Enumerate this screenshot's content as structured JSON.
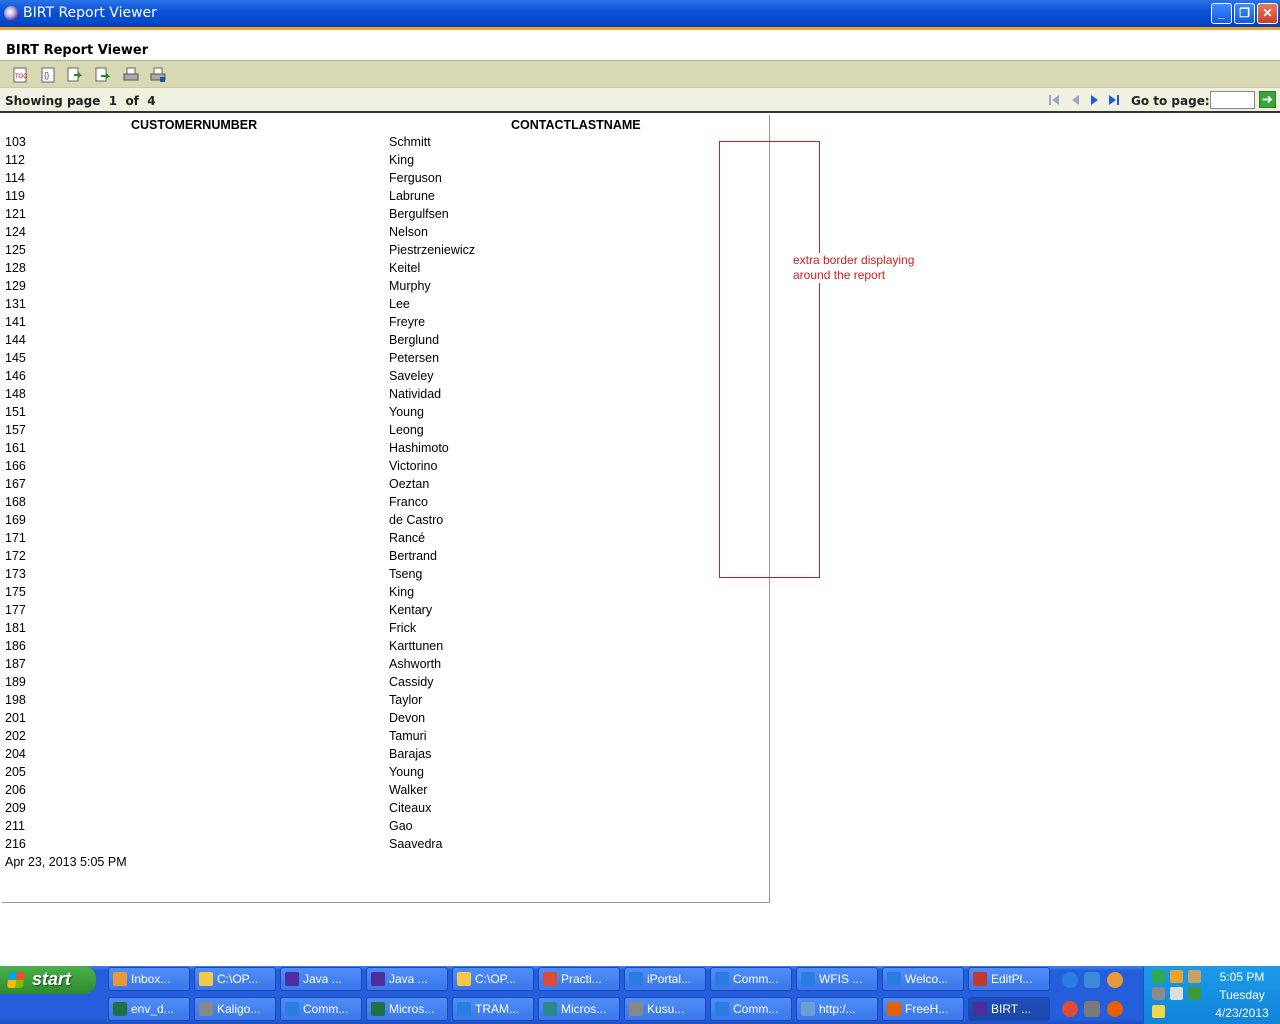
{
  "window": {
    "title": "BIRT Report Viewer",
    "buttons": {
      "minimize": "_",
      "maximize": "❐",
      "close": "✕"
    }
  },
  "report_title": "BIRT Report Viewer",
  "toolbar": {
    "icons": [
      "toc-icon",
      "parameters-icon",
      "export-data-icon",
      "export-report-icon",
      "print-icon",
      "print-server-icon"
    ]
  },
  "navigation": {
    "showing_label": "Showing page",
    "current_page": "1",
    "of_label": "of",
    "total_pages": "4",
    "goto_label": "Go to page:"
  },
  "table": {
    "headers": [
      "CUSTOMERNUMBER",
      "CONTACTLASTNAME"
    ],
    "rows": [
      [
        "103",
        "Schmitt"
      ],
      [
        "112",
        "King"
      ],
      [
        "114",
        "Ferguson"
      ],
      [
        "119",
        "Labrune"
      ],
      [
        "121",
        "Bergulfsen"
      ],
      [
        "124",
        "Nelson"
      ],
      [
        "125",
        "Piestrzeniewicz"
      ],
      [
        "128",
        "Keitel"
      ],
      [
        "129",
        "Murphy"
      ],
      [
        "131",
        "Lee"
      ],
      [
        "141",
        "Freyre"
      ],
      [
        "144",
        "Berglund"
      ],
      [
        "145",
        "Petersen"
      ],
      [
        "146",
        "Saveley"
      ],
      [
        "148",
        "Natividad"
      ],
      [
        "151",
        "Young"
      ],
      [
        "157",
        "Leong"
      ],
      [
        "161",
        "Hashimoto"
      ],
      [
        "166",
        "Victorino"
      ],
      [
        "167",
        "Oeztan"
      ],
      [
        "168",
        "Franco"
      ],
      [
        "169",
        "de Castro"
      ],
      [
        "171",
        "Rancé"
      ],
      [
        "172",
        "Bertrand"
      ],
      [
        "173",
        "Tseng"
      ],
      [
        "175",
        "King"
      ],
      [
        "177",
        "Kentary"
      ],
      [
        "181",
        "Frick"
      ],
      [
        "186",
        "Karttunen"
      ],
      [
        "187",
        "Ashworth"
      ],
      [
        "189",
        "Cassidy"
      ],
      [
        "198",
        "Taylor"
      ],
      [
        "201",
        "Devon"
      ],
      [
        "202",
        "Tamuri"
      ],
      [
        "204",
        "Barajas"
      ],
      [
        "205",
        "Young"
      ],
      [
        "206",
        "Walker"
      ],
      [
        "209",
        "Citeaux"
      ],
      [
        "211",
        "Gao"
      ],
      [
        "216",
        "Saavedra"
      ]
    ]
  },
  "footer_date": "Apr 23, 2013 5:05 PM",
  "annotation": {
    "line1": "extra border displaying",
    "line2": "around the report",
    "color": "#cc2020"
  },
  "taskbar": {
    "start_label": "start",
    "row1": [
      {
        "label": "Inbox...",
        "icon": "thunderbird-icon",
        "color": "#e89a3a"
      },
      {
        "label": "C:\\OP...",
        "icon": "folder-icon",
        "color": "#f2c94c"
      },
      {
        "label": "Java ...",
        "icon": "eclipse-icon",
        "color": "#4c2f9c"
      },
      {
        "label": "Java ...",
        "icon": "eclipse-icon",
        "color": "#4c2f9c"
      },
      {
        "label": "C:\\OP...",
        "icon": "folder-icon",
        "color": "#f2c94c"
      },
      {
        "label": "Practi...",
        "icon": "chrome-icon",
        "color": "#dd4b39"
      },
      {
        "label": "iPortal...",
        "icon": "ie-icon",
        "color": "#2a7de1"
      },
      {
        "label": "Comm...",
        "icon": "ie-icon",
        "color": "#2a7de1"
      },
      {
        "label": "WFIS ...",
        "icon": "ie-icon",
        "color": "#2a7de1"
      },
      {
        "label": "Welco...",
        "icon": "ie-icon",
        "color": "#2a7de1"
      },
      {
        "label": "EditPl...",
        "icon": "editplus-icon",
        "color": "#c0392b"
      }
    ],
    "row2": [
      {
        "label": "env_d...",
        "icon": "excel-icon",
        "color": "#1e7145"
      },
      {
        "label": "Kaligo...",
        "icon": "messenger-icon",
        "color": "#888888"
      },
      {
        "label": "Comm...",
        "icon": "ie-icon",
        "color": "#2a7de1"
      },
      {
        "label": "Micros...",
        "icon": "excel-icon",
        "color": "#1e7145"
      },
      {
        "label": "TRAM...",
        "icon": "ie-icon",
        "color": "#2a7de1"
      },
      {
        "label": "Micros...",
        "icon": "lync-icon",
        "color": "#2a8a8a"
      },
      {
        "label": "Kusu...",
        "icon": "messenger-icon",
        "color": "#888888"
      },
      {
        "label": "Comm...",
        "icon": "ie-icon",
        "color": "#2a7de1"
      },
      {
        "label": "http:/...",
        "icon": "notepad-icon",
        "color": "#6a9fd8"
      },
      {
        "label": "FreeH...",
        "icon": "firefox-icon",
        "color": "#e66000"
      },
      {
        "label": "BIRT ...",
        "icon": "eclipse-icon",
        "color": "#4c2f9c",
        "active": true
      }
    ],
    "clock": {
      "time": "5:05 PM",
      "day": "Tuesday",
      "date": "4/23/2013"
    }
  }
}
